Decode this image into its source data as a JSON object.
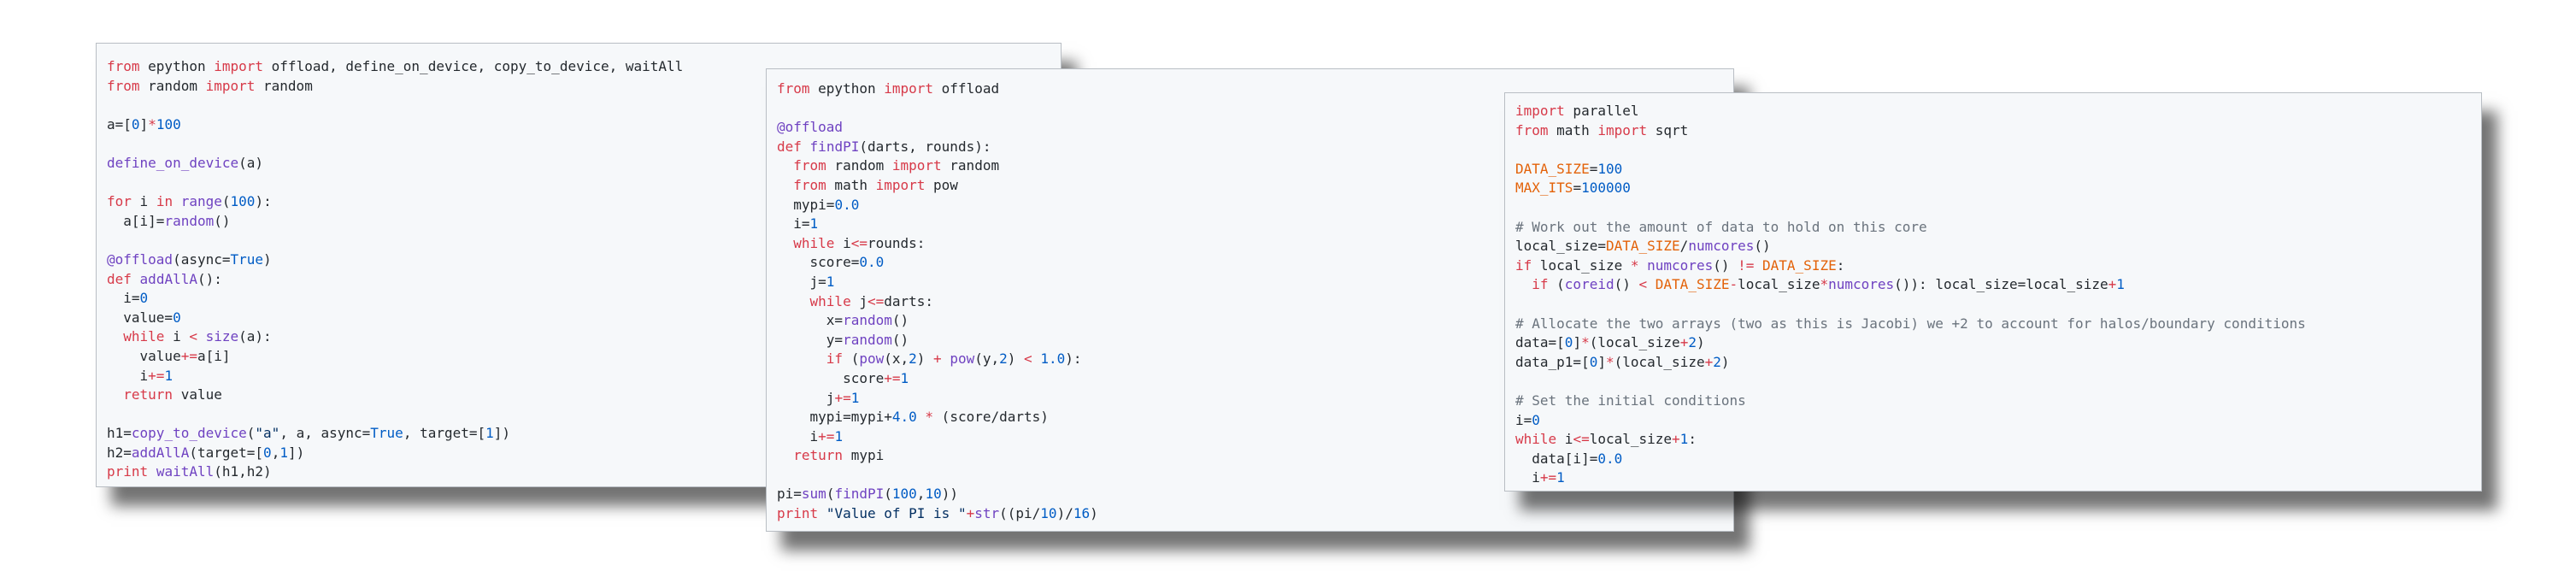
{
  "theme": {
    "panel_background": "#f6f8fa",
    "panel_border": "#b9bec4",
    "text": "#24292e",
    "keyword": "#d73a49",
    "function": "#6f42c1",
    "number": "#005cc5",
    "string": "#032f62",
    "variable": "#e36209",
    "comment": "#6a737d"
  },
  "panels": [
    {
      "lines": [
        [
          [
            "kw",
            "from"
          ],
          [
            "p",
            " epython "
          ],
          [
            "kw",
            "import"
          ],
          [
            "p",
            " offload, define_on_device, copy_to_device, waitAll"
          ]
        ],
        [
          [
            "kw",
            "from"
          ],
          [
            "p",
            " random "
          ],
          [
            "kw",
            "import"
          ],
          [
            "p",
            " random"
          ]
        ],
        [],
        [
          [
            "p",
            "a="
          ],
          [
            "p",
            "["
          ],
          [
            "num",
            "0"
          ],
          [
            "p",
            "]"
          ],
          [
            "op",
            "*"
          ],
          [
            "num",
            "100"
          ]
        ],
        [],
        [
          [
            "fn",
            "define_on_device"
          ],
          [
            "p",
            "(a)"
          ]
        ],
        [],
        [
          [
            "kw",
            "for"
          ],
          [
            "p",
            " i "
          ],
          [
            "kw",
            "in"
          ],
          [
            "p",
            " "
          ],
          [
            "fn",
            "range"
          ],
          [
            "p",
            "("
          ],
          [
            "num",
            "100"
          ],
          [
            "p",
            "):"
          ]
        ],
        [
          [
            "p",
            "  a[i]="
          ],
          [
            "fn",
            "random"
          ],
          [
            "p",
            "()"
          ]
        ],
        [],
        [
          [
            "dec",
            "@offload"
          ],
          [
            "p",
            "("
          ],
          [
            "p",
            "async="
          ],
          [
            "num",
            "True"
          ],
          [
            "p",
            ")"
          ]
        ],
        [
          [
            "kw",
            "def"
          ],
          [
            "p",
            " "
          ],
          [
            "fn",
            "addAllA"
          ],
          [
            "p",
            "():"
          ]
        ],
        [
          [
            "p",
            "  i="
          ],
          [
            "num",
            "0"
          ]
        ],
        [
          [
            "p",
            "  value="
          ],
          [
            "num",
            "0"
          ]
        ],
        [
          [
            "p",
            "  "
          ],
          [
            "kw",
            "while"
          ],
          [
            "p",
            " i "
          ],
          [
            "op",
            "<"
          ],
          [
            "p",
            " "
          ],
          [
            "fn",
            "size"
          ],
          [
            "p",
            "(a):"
          ]
        ],
        [
          [
            "p",
            "    value"
          ],
          [
            "op",
            "+="
          ],
          [
            "p",
            "a[i]"
          ]
        ],
        [
          [
            "p",
            "    i"
          ],
          [
            "op",
            "+="
          ],
          [
            "num",
            "1"
          ]
        ],
        [
          [
            "p",
            "  "
          ],
          [
            "kw",
            "return"
          ],
          [
            "p",
            " value"
          ]
        ],
        [],
        [
          [
            "p",
            "h1="
          ],
          [
            "fn",
            "copy_to_device"
          ],
          [
            "p",
            "("
          ],
          [
            "str",
            "\"a\""
          ],
          [
            "p",
            ", a, async="
          ],
          [
            "num",
            "True"
          ],
          [
            "p",
            ", target=["
          ],
          [
            "num",
            "1"
          ],
          [
            "p",
            "])"
          ]
        ],
        [
          [
            "p",
            "h2="
          ],
          [
            "fn",
            "addAllA"
          ],
          [
            "p",
            "(target=["
          ],
          [
            "num",
            "0"
          ],
          [
            "p",
            ","
          ],
          [
            "num",
            "1"
          ],
          [
            "p",
            "])"
          ]
        ],
        [
          [
            "kw",
            "print"
          ],
          [
            "p",
            " "
          ],
          [
            "fn",
            "waitAll"
          ],
          [
            "p",
            "(h1,h2)"
          ]
        ]
      ]
    },
    {
      "lines": [
        [
          [
            "kw",
            "from"
          ],
          [
            "p",
            " epython "
          ],
          [
            "kw",
            "import"
          ],
          [
            "p",
            " offload"
          ]
        ],
        [],
        [
          [
            "dec",
            "@offload"
          ]
        ],
        [
          [
            "kw",
            "def"
          ],
          [
            "p",
            " "
          ],
          [
            "fn",
            "findPI"
          ],
          [
            "p",
            "(darts, rounds):"
          ]
        ],
        [
          [
            "p",
            "  "
          ],
          [
            "kw",
            "from"
          ],
          [
            "p",
            " random "
          ],
          [
            "kw",
            "import"
          ],
          [
            "p",
            " random"
          ]
        ],
        [
          [
            "p",
            "  "
          ],
          [
            "kw",
            "from"
          ],
          [
            "p",
            " math "
          ],
          [
            "kw",
            "import"
          ],
          [
            "p",
            " pow"
          ]
        ],
        [
          [
            "p",
            "  mypi="
          ],
          [
            "num",
            "0.0"
          ]
        ],
        [
          [
            "p",
            "  i="
          ],
          [
            "num",
            "1"
          ]
        ],
        [
          [
            "p",
            "  "
          ],
          [
            "kw",
            "while"
          ],
          [
            "p",
            " i"
          ],
          [
            "op",
            "<="
          ],
          [
            "p",
            "rounds:"
          ]
        ],
        [
          [
            "p",
            "    score="
          ],
          [
            "num",
            "0.0"
          ]
        ],
        [
          [
            "p",
            "    j="
          ],
          [
            "num",
            "1"
          ]
        ],
        [
          [
            "p",
            "    "
          ],
          [
            "kw",
            "while"
          ],
          [
            "p",
            " j"
          ],
          [
            "op",
            "<="
          ],
          [
            "p",
            "darts:"
          ]
        ],
        [
          [
            "p",
            "      x="
          ],
          [
            "fn",
            "random"
          ],
          [
            "p",
            "()"
          ]
        ],
        [
          [
            "p",
            "      y="
          ],
          [
            "fn",
            "random"
          ],
          [
            "p",
            "()"
          ]
        ],
        [
          [
            "p",
            "      "
          ],
          [
            "kw",
            "if"
          ],
          [
            "p",
            " ("
          ],
          [
            "fn",
            "pow"
          ],
          [
            "p",
            "(x,"
          ],
          [
            "num",
            "2"
          ],
          [
            "p",
            ") "
          ],
          [
            "op",
            "+"
          ],
          [
            "p",
            " "
          ],
          [
            "fn",
            "pow"
          ],
          [
            "p",
            "(y,"
          ],
          [
            "num",
            "2"
          ],
          [
            "p",
            ") "
          ],
          [
            "op",
            "<"
          ],
          [
            "p",
            " "
          ],
          [
            "num",
            "1.0"
          ],
          [
            "p",
            "):"
          ]
        ],
        [
          [
            "p",
            "        score"
          ],
          [
            "op",
            "+="
          ],
          [
            "num",
            "1"
          ]
        ],
        [
          [
            "p",
            "      j"
          ],
          [
            "op",
            "+="
          ],
          [
            "num",
            "1"
          ]
        ],
        [
          [
            "p",
            "    mypi=mypi+"
          ],
          [
            "num",
            "4.0"
          ],
          [
            "p",
            " "
          ],
          [
            "op",
            "*"
          ],
          [
            "p",
            " (score/darts)"
          ]
        ],
        [
          [
            "p",
            "    i"
          ],
          [
            "op",
            "+="
          ],
          [
            "num",
            "1"
          ]
        ],
        [
          [
            "p",
            "  "
          ],
          [
            "kw",
            "return"
          ],
          [
            "p",
            " mypi"
          ]
        ],
        [],
        [
          [
            "p",
            "pi="
          ],
          [
            "fn",
            "sum"
          ],
          [
            "p",
            "("
          ],
          [
            "fn",
            "findPI"
          ],
          [
            "p",
            "("
          ],
          [
            "num",
            "100"
          ],
          [
            "p",
            ","
          ],
          [
            "num",
            "10"
          ],
          [
            "p",
            "))"
          ]
        ],
        [
          [
            "kw",
            "print"
          ],
          [
            "p",
            " "
          ],
          [
            "str",
            "\"Value of PI is \""
          ],
          [
            "op",
            "+"
          ],
          [
            "fn",
            "str"
          ],
          [
            "p",
            "((pi/"
          ],
          [
            "num",
            "10"
          ],
          [
            "p",
            ")/"
          ],
          [
            "num",
            "16"
          ],
          [
            "p",
            ")"
          ]
        ]
      ]
    },
    {
      "lines": [
        [
          [
            "kw",
            "import"
          ],
          [
            "p",
            " parallel"
          ]
        ],
        [
          [
            "kw",
            "from"
          ],
          [
            "p",
            " math "
          ],
          [
            "kw",
            "import"
          ],
          [
            "p",
            " sqrt"
          ]
        ],
        [],
        [
          [
            "var",
            "DATA_SIZE"
          ],
          [
            "p",
            "="
          ],
          [
            "num",
            "100"
          ]
        ],
        [
          [
            "var",
            "MAX_ITS"
          ],
          [
            "p",
            "="
          ],
          [
            "num",
            "100000"
          ]
        ],
        [],
        [
          [
            "cmt",
            "# Work out the amount of data to hold on this core"
          ]
        ],
        [
          [
            "p",
            "local_size="
          ],
          [
            "var",
            "DATA_SIZE"
          ],
          [
            "p",
            "/"
          ],
          [
            "fn",
            "numcores"
          ],
          [
            "p",
            "()"
          ]
        ],
        [
          [
            "kw",
            "if"
          ],
          [
            "p",
            " local_size "
          ],
          [
            "op",
            "*"
          ],
          [
            "p",
            " "
          ],
          [
            "fn",
            "numcores"
          ],
          [
            "p",
            "() "
          ],
          [
            "op",
            "!="
          ],
          [
            "p",
            " "
          ],
          [
            "var",
            "DATA_SIZE"
          ],
          [
            "p",
            ":"
          ]
        ],
        [
          [
            "p",
            "  "
          ],
          [
            "kw",
            "if"
          ],
          [
            "p",
            " ("
          ],
          [
            "fn",
            "coreid"
          ],
          [
            "p",
            "() "
          ],
          [
            "op",
            "<"
          ],
          [
            "p",
            " "
          ],
          [
            "var",
            "DATA_SIZE"
          ],
          [
            "op",
            "-"
          ],
          [
            "p",
            "local_size"
          ],
          [
            "op",
            "*"
          ],
          [
            "fn",
            "numcores"
          ],
          [
            "p",
            "()): local_size=local_size"
          ],
          [
            "op",
            "+"
          ],
          [
            "num",
            "1"
          ]
        ],
        [],
        [
          [
            "cmt",
            "# Allocate the two arrays (two as this is Jacobi) we +2 to account for halos/boundary conditions"
          ]
        ],
        [
          [
            "p",
            "data=["
          ],
          [
            "num",
            "0"
          ],
          [
            "p",
            "]"
          ],
          [
            "op",
            "*"
          ],
          [
            "p",
            "(local_size"
          ],
          [
            "op",
            "+"
          ],
          [
            "num",
            "2"
          ],
          [
            "p",
            ")"
          ]
        ],
        [
          [
            "p",
            "data_p1=["
          ],
          [
            "num",
            "0"
          ],
          [
            "p",
            "]"
          ],
          [
            "op",
            "*"
          ],
          [
            "p",
            "(local_size"
          ],
          [
            "op",
            "+"
          ],
          [
            "num",
            "2"
          ],
          [
            "p",
            ")"
          ]
        ],
        [],
        [
          [
            "cmt",
            "# Set the initial conditions"
          ]
        ],
        [
          [
            "p",
            "i="
          ],
          [
            "num",
            "0"
          ]
        ],
        [
          [
            "kw",
            "while"
          ],
          [
            "p",
            " i"
          ],
          [
            "op",
            "<="
          ],
          [
            "p",
            "local_size"
          ],
          [
            "op",
            "+"
          ],
          [
            "num",
            "1"
          ],
          [
            "p",
            ":"
          ]
        ],
        [
          [
            "p",
            "  data[i]="
          ],
          [
            "num",
            "0.0"
          ]
        ],
        [
          [
            "p",
            "  i"
          ],
          [
            "op",
            "+="
          ],
          [
            "num",
            "1"
          ]
        ]
      ]
    }
  ]
}
